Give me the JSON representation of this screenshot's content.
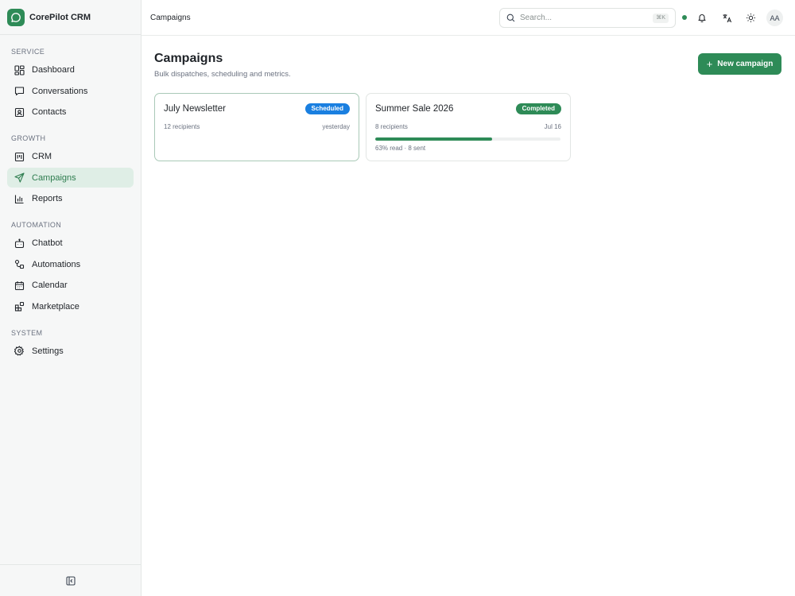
{
  "app": {
    "name": "CorePilot CRM"
  },
  "sidebar": {
    "sections": [
      {
        "title": "SERVICE",
        "items": [
          {
            "label": "Dashboard",
            "icon": "dashboard-icon"
          },
          {
            "label": "Conversations",
            "icon": "conversations-icon"
          },
          {
            "label": "Contacts",
            "icon": "contacts-icon"
          }
        ]
      },
      {
        "title": "GROWTH",
        "items": [
          {
            "label": "CRM",
            "icon": "crm-icon"
          },
          {
            "label": "Campaigns",
            "icon": "send-icon",
            "active": true
          },
          {
            "label": "Reports",
            "icon": "reports-icon"
          }
        ]
      },
      {
        "title": "AUTOMATION",
        "items": [
          {
            "label": "Chatbot",
            "icon": "chatbot-icon"
          },
          {
            "label": "Automations",
            "icon": "automations-icon"
          },
          {
            "label": "Calendar",
            "icon": "calendar-icon"
          },
          {
            "label": "Marketplace",
            "icon": "marketplace-icon"
          }
        ]
      },
      {
        "title": "SYSTEM",
        "items": [
          {
            "label": "Settings",
            "icon": "gear-icon"
          }
        ]
      }
    ]
  },
  "topbar": {
    "breadcrumb": "Campaigns",
    "search": {
      "placeholder": "Search...",
      "shortcut": "⌘K"
    },
    "status_color": "#2e8b57",
    "avatar_initials": "AA"
  },
  "page": {
    "title": "Campaigns",
    "subtitle": "Bulk dispatches, scheduling and metrics.",
    "new_button_label": "New campaign"
  },
  "campaigns": [
    {
      "name": "July Newsletter",
      "status": "Scheduled",
      "recipients": "12 recipients",
      "date": "yesterday"
    },
    {
      "name": "Summer Sale 2026",
      "status": "Completed",
      "recipients": "8 recipients",
      "date": "Jul 16",
      "read_fraction": 0.63,
      "stats": "63% read · 8 sent"
    }
  ],
  "colors": {
    "accent": "#2e8b57",
    "scheduled": "#1a7fe0",
    "active_bg": "#dfeee6"
  }
}
